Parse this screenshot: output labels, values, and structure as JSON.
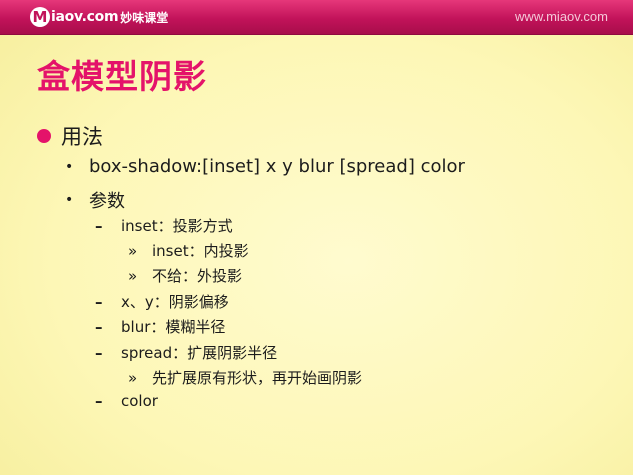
{
  "header": {
    "brand_mark": "M",
    "brand_text": "iaov.com",
    "brand_cn": "妙味课堂",
    "url": "www.miaov.com"
  },
  "slide": {
    "title": "盒模型阴影",
    "section": "用法",
    "items": {
      "syntax": "box-shadow:[inset] x y blur [spread] color",
      "params": "参数",
      "inset": "inset：投影方式",
      "inset_inner": "inset：内投影",
      "inset_none": "不给：外投影",
      "xy": "x、y：阴影偏移",
      "blur": "blur：模糊半径",
      "spread": "spread：扩展阴影半径",
      "spread_desc": "先扩展原有形状，再开始画阴影",
      "color": "color"
    }
  },
  "bullets": {
    "level2": "•",
    "level3": "–",
    "level4": "»"
  },
  "colors": {
    "header": "#c2135a",
    "title": "#e4136a",
    "background": "#fdf8b8",
    "text": "#1c1c1c"
  }
}
